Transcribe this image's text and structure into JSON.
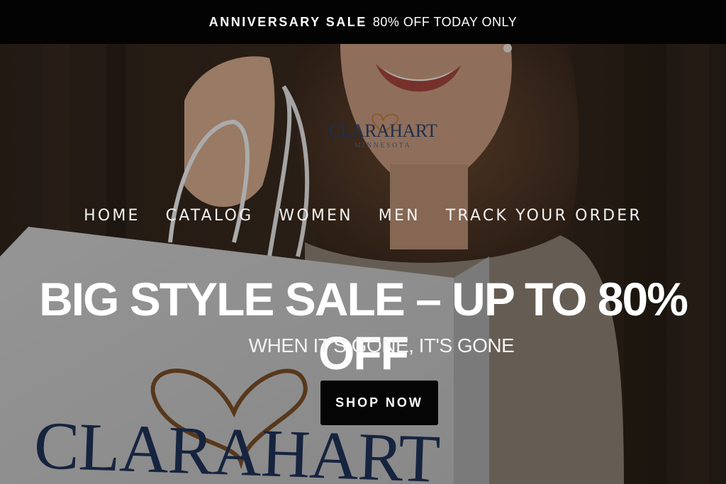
{
  "announcement": {
    "strong_text": "ANNIVERSARY SALE",
    "rest_text": "80% OFF TODAY ONLY"
  },
  "brand": {
    "name": "CLARAHART",
    "sub": "MINNESOTA",
    "bag_name": "CLARAHART"
  },
  "nav": {
    "items": [
      "HOME",
      "CATALOG",
      "WOMEN",
      "MEN",
      "TRACK YOUR ORDER"
    ]
  },
  "hero": {
    "headline": "BIG STYLE SALE – UP TO 80% OFF",
    "subheadline": "WHEN IT'S GONE, IT'S GONE",
    "cta_label": "SHOP NOW"
  },
  "colors": {
    "announcement_bg": "#030303",
    "logo_navy": "#1f2f4f",
    "heart_brown": "#8a5a2b",
    "button_bg": "#050505"
  }
}
